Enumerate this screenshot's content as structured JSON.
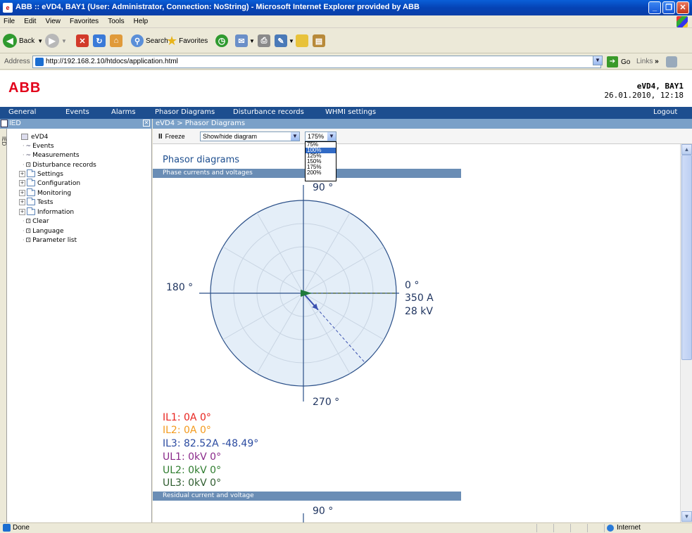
{
  "window": {
    "title": "ABB :: eVD4, BAY1 (User: Administrator, Connection: NoString) - Microsoft Internet Explorer provided by ABB"
  },
  "menubar": [
    "File",
    "Edit",
    "View",
    "Favorites",
    "Tools",
    "Help"
  ],
  "toolbar": {
    "back": "Back",
    "search": "Search",
    "favorites": "Favorites"
  },
  "address": {
    "label": "Address",
    "url": "http://192.168.2.10/htdocs/application.html",
    "go": "Go",
    "links": "Links"
  },
  "header": {
    "logo": "ABB",
    "device": "eVD4, BAY1",
    "datetime": "26.01.2010, 12:18"
  },
  "nav": {
    "items": [
      "General",
      "Events",
      "Alarms",
      "Phasor Diagrams",
      "Disturbance records",
      "WHMI settings"
    ],
    "logout": "Logout"
  },
  "sidebar": {
    "title": "IED",
    "vtab": "IED",
    "root": "eVD4",
    "items": [
      {
        "label": "Events"
      },
      {
        "label": "Measurements"
      },
      {
        "label": "Disturbance records"
      },
      {
        "label": "Settings"
      },
      {
        "label": "Configuration"
      },
      {
        "label": "Monitoring"
      },
      {
        "label": "Tests"
      },
      {
        "label": "Information"
      },
      {
        "label": "Clear"
      },
      {
        "label": "Language"
      },
      {
        "label": "Parameter list"
      }
    ]
  },
  "content": {
    "breadcrumb": "eVD4 > Phasor Diagrams",
    "freeze": "Freeze",
    "diagram_select": "Show/hide diagram",
    "zoom_value": "175%",
    "zoom_options": [
      "75%",
      "100%",
      "125%",
      "150%",
      "175%",
      "200%"
    ],
    "zoom_highlighted": "100%",
    "page_title": "Phasor diagrams",
    "section1": "Phase currents and voltages",
    "section2": "Residual current and voltage",
    "angle_90": "90 °",
    "angle_180": "180 °",
    "angle_0": "0 °",
    "angle_270": "270 °",
    "scale_current": "350 A",
    "scale_voltage": "28 kV",
    "readings": [
      {
        "label": "IL1: 0A 0°",
        "color": "#e8231e"
      },
      {
        "label": "IL2: 0A 0°",
        "color": "#f39a1d"
      },
      {
        "label": "IL3: 82.52A -48.49°",
        "color": "#2a4aa0"
      },
      {
        "label": "UL1: 0kV 0°",
        "color": "#8a2a8a"
      },
      {
        "label": "UL2: 0kV 0°",
        "color": "#2f7d2f"
      },
      {
        "label": "UL3: 0kV 0°",
        "color": "#2f5d2f"
      }
    ],
    "phasors": [
      {
        "name": "IL3",
        "magnitude": 82.52,
        "angle_deg": -48.49,
        "color": "#3a50b0"
      }
    ],
    "section2_angle_90": "90 °"
  },
  "status": {
    "text": "Done",
    "zone": "Internet"
  }
}
